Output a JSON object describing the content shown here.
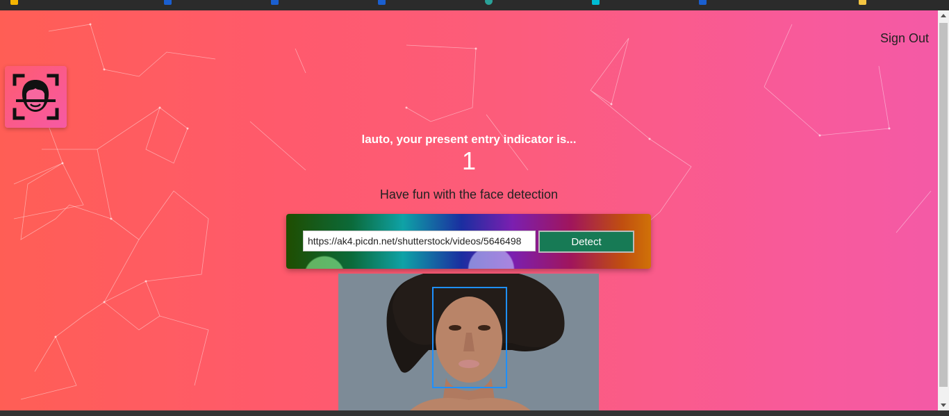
{
  "header": {
    "sign_out_label": "Sign Out"
  },
  "rank": {
    "message": "lauto, your present entry indicator is...",
    "count": "1"
  },
  "detector": {
    "instructions": "Have fun with the face detection",
    "image_url": "https://ak4.picdn.net/shutterstock/videos/5646498",
    "detect_label": "Detect"
  },
  "icons": {
    "logo": "face-scan-icon"
  },
  "colors": {
    "gradient_start": "#ff5e55",
    "gradient_end": "#f45aa6",
    "detect_button": "#177a55",
    "face_box": "#1e90ff"
  }
}
